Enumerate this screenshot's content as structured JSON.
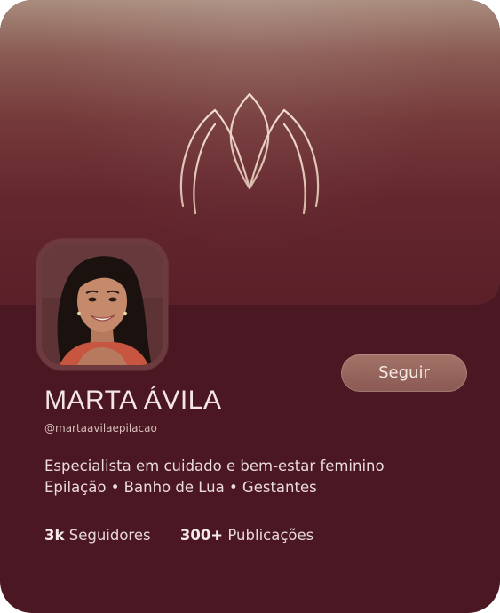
{
  "profile": {
    "name": "MARTA ÁVILA",
    "handle": "@martaavilaepilacao",
    "bio_line1": "Especialista em cuidado e bem-estar feminino",
    "bio_line2": "Epilação • Banho de Lua • Gestantes"
  },
  "actions": {
    "follow_label": "Seguir"
  },
  "stats": {
    "followers_count": "3k",
    "followers_label": "Seguidores",
    "posts_count": "300+",
    "posts_label": "Publicações"
  },
  "icons": {
    "logo": "lotus-m-logo-icon"
  },
  "colors": {
    "card_background": "#4a1722",
    "cover_top": "#a98c7d",
    "cover_bottom": "#5a1f28",
    "button": "#9a6a60",
    "logo_stroke": "#e6cfc0"
  }
}
